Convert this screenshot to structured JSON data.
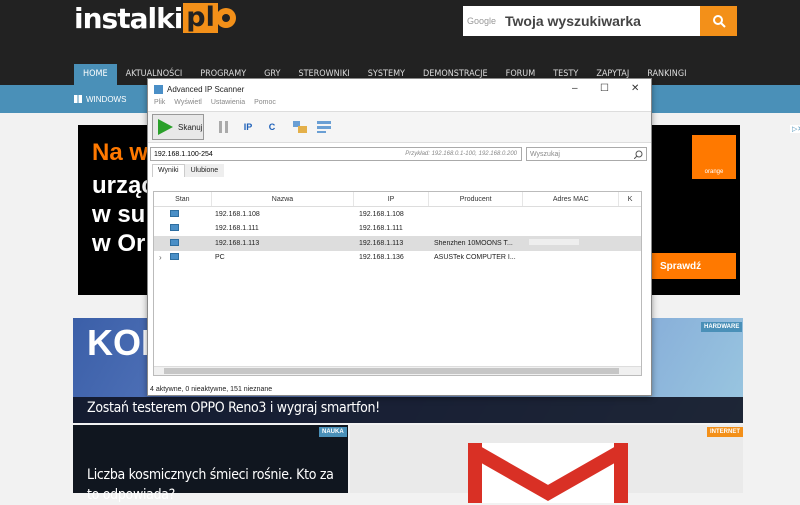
{
  "site": {
    "logo_text": "instalki",
    "logo_suffix": "pl",
    "search_hint": "Google",
    "search_placeholder": "Twoja wyszukiwarka",
    "nav": [
      "HOME",
      "AKTUALNOŚCI",
      "PROGRAMY",
      "GRY",
      "STEROWNIKI",
      "SYSTEMY",
      "DEMONSTRACJE",
      "FORUM",
      "TESTY",
      "ZAPYTAJ",
      "RANKINGI"
    ],
    "subnav": "WINDOWS"
  },
  "ad": {
    "lines": [
      "Na w",
      "urząc",
      "w su",
      "w Or"
    ],
    "brand": "orange",
    "cta": "Sprawdź"
  },
  "articles": [
    {
      "kon": "KONI",
      "badge": "HARDWARE",
      "title": "Zostań testerem OPPO Reno3 i wygraj smartfon!"
    },
    {
      "badge": "NAUKA",
      "title": "Liczba kosmicznych śmieci rośnie. Kto za to odpowiada?"
    },
    {
      "badge": "INTERNET"
    }
  ],
  "app": {
    "title": "Advanced IP Scanner",
    "menu": [
      "Plik",
      "Wyświetl",
      "Ustawienia",
      "Pomoc"
    ],
    "scan_label": "Skanuj",
    "range": "192.168.1.100-254",
    "range_hint": "Przykład: 192.168.0.1-100, 192.168.0.200",
    "search_placeholder": "Wyszukaj",
    "tabs": [
      "Wyniki",
      "Ulubione"
    ],
    "columns": [
      "Stan",
      "Nazwa",
      "IP",
      "Producent",
      "Adres MAC",
      "K"
    ],
    "rows": [
      {
        "name": "192.168.1.108",
        "ip": "192.168.1.108",
        "vendor": "",
        "selected": false,
        "expand": false
      },
      {
        "name": "192.168.1.111",
        "ip": "192.168.1.111",
        "vendor": "",
        "selected": false,
        "expand": false
      },
      {
        "name": "192.168.1.113",
        "ip": "192.168.1.113",
        "vendor": "Shenzhen 10MOONS T...",
        "selected": true,
        "expand": false
      },
      {
        "name": "PC",
        "ip": "192.168.1.136",
        "vendor": "ASUSTek COMPUTER I...",
        "selected": false,
        "expand": true
      }
    ],
    "status": "4 aktywne, 0 nieaktywne, 151 nieznane",
    "colors": {
      "accent": "#f39019",
      "nav_blue": "#4a90b8",
      "scan_green": "#2aa02a"
    }
  }
}
